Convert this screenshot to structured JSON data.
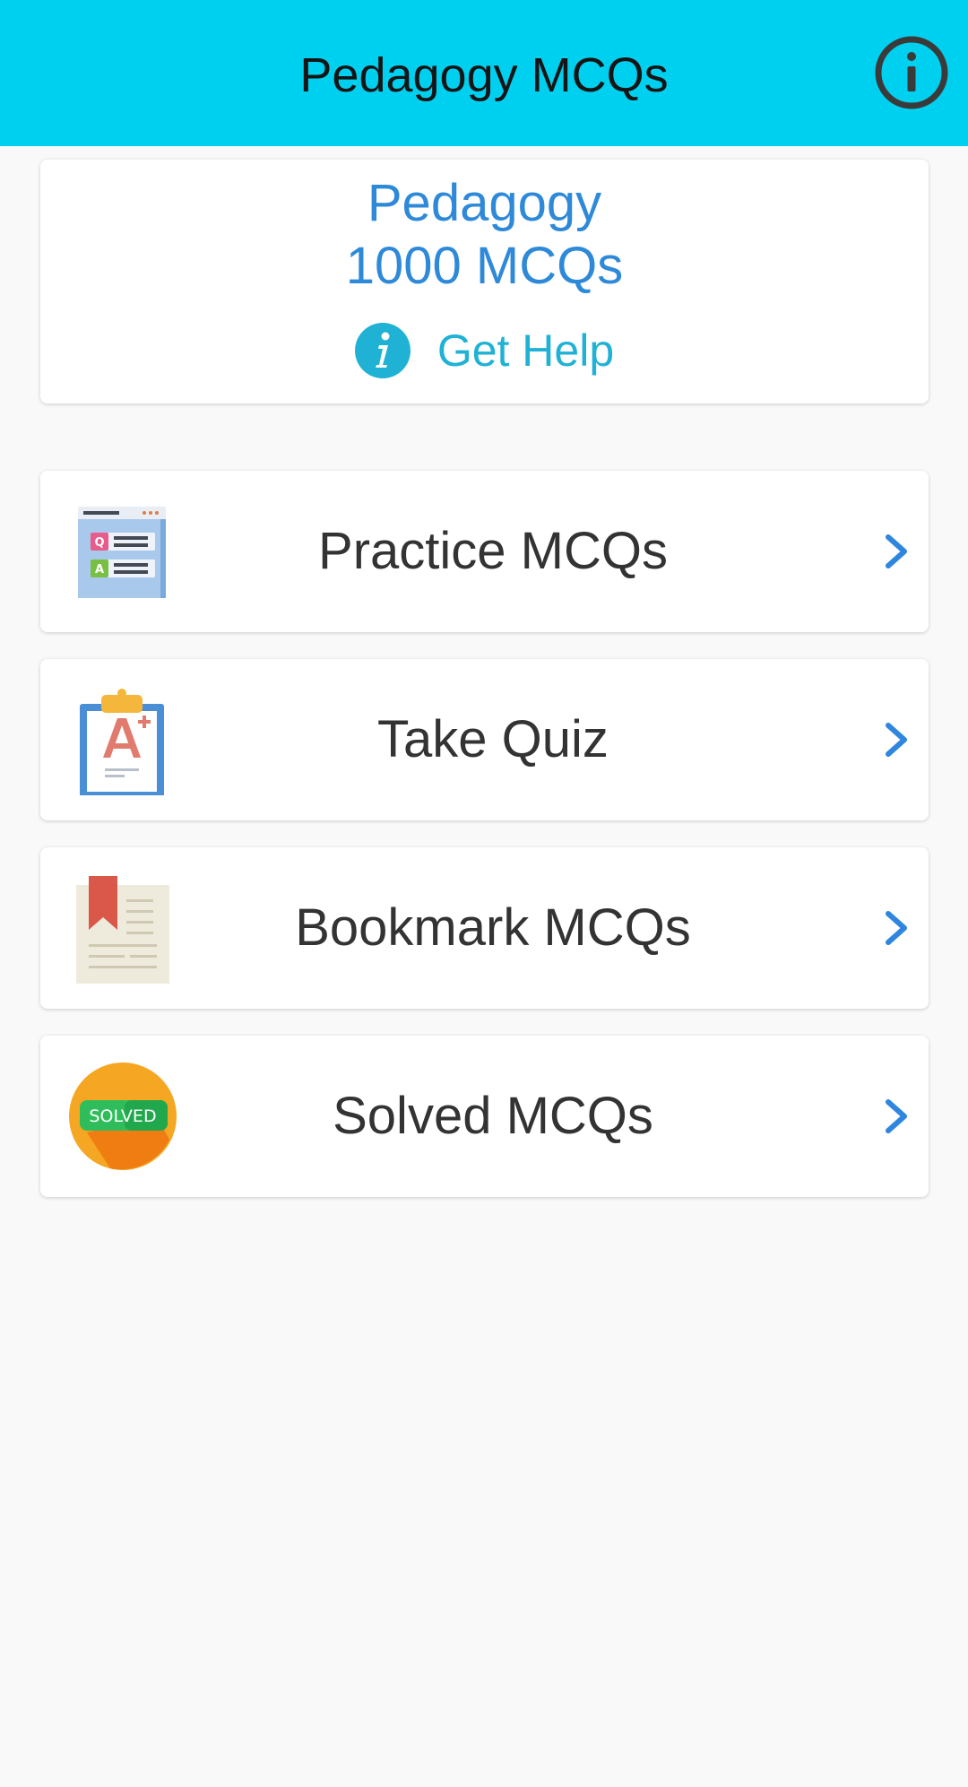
{
  "app_bar": {
    "title": "Pedagogy MCQs",
    "info_icon": "info-circle-icon"
  },
  "header_card": {
    "title_line1": "Pedagogy",
    "title_line2": "1000 MCQs",
    "help_label": "Get Help",
    "help_icon": "info-icon"
  },
  "menu": {
    "items": [
      {
        "label": "Practice MCQs",
        "icon": "qa-list-icon"
      },
      {
        "label": "Take Quiz",
        "icon": "clipboard-grade-icon"
      },
      {
        "label": "Bookmark MCQs",
        "icon": "bookmark-document-icon"
      },
      {
        "label": "Solved MCQs",
        "icon": "solved-badge-icon",
        "badge_text": "SOLVED"
      }
    ]
  },
  "colors": {
    "app_bar": "#00d0f0",
    "title_blue": "#2e8ad8",
    "help_cyan": "#1fb2d4",
    "chevron": "#2e86de",
    "background": "#f9f9f9"
  }
}
